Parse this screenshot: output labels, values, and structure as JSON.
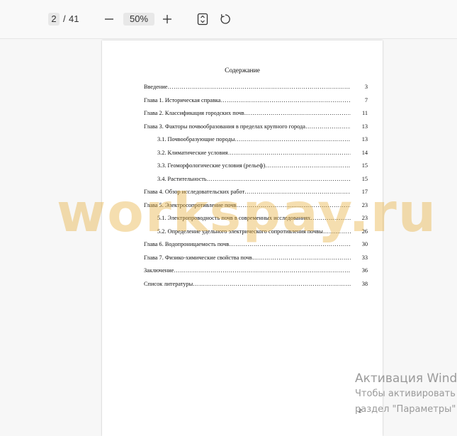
{
  "toolbar": {
    "current_page": "2",
    "page_separator": "/",
    "total_pages": "41",
    "zoom": "50%",
    "icons": {
      "zoom_out": "minus-icon",
      "zoom_in": "plus-icon",
      "fit": "fit-page-icon",
      "rotate": "rotate-icon"
    }
  },
  "document": {
    "title": "Содержание",
    "toc": [
      {
        "text": "Введение",
        "page": "3",
        "indent": false
      },
      {
        "text": "Глава 1. Историческая справка",
        "page": "7",
        "indent": false
      },
      {
        "text": "Глава 2. Классификация городских почв",
        "page": "11",
        "indent": false
      },
      {
        "text": "Глава 3. Факторы почвообразования в пределах крупного города",
        "page": "13",
        "indent": false
      },
      {
        "text": "3.1. Почвообразующие породы",
        "page": "13",
        "indent": true
      },
      {
        "text": "3.2. Климатические условия",
        "page": "14",
        "indent": true
      },
      {
        "text": "3.3. Геоморфологические условия (рельеф)",
        "page": "15",
        "indent": true
      },
      {
        "text": "3.4. Растительность",
        "page": "15",
        "indent": true
      },
      {
        "text": "Глава 4. Обзор исследовательских работ",
        "page": "17",
        "indent": false
      },
      {
        "text": "Глава 5. Электросопротивление почв",
        "page": "23",
        "indent": false
      },
      {
        "text": "5.1. Электропроводность почв в современных исследованиях",
        "page": "23",
        "indent": true
      },
      {
        "text": "5.2. Определение удельного электрического сопротивления почвы",
        "page": "26",
        "indent": true
      },
      {
        "text": "Глава 6. Водопроницаемость почв",
        "page": "30",
        "indent": false
      },
      {
        "text": "Глава 7. Физико-химические свойства почв",
        "page": "33",
        "indent": false
      },
      {
        "text": "Заключение",
        "page": "36",
        "indent": false
      },
      {
        "text": "Список литературы",
        "page": "38",
        "indent": false
      }
    ],
    "footer_page_number": "2"
  },
  "watermark": "workspay.ru",
  "activation": {
    "line1": "Активация Wind",
    "line2": "Чтобы активировать",
    "line3": "раздел \"Параметры\""
  },
  "colors": {
    "watermark": "#e8b040",
    "activation_text": "#9a9a9a",
    "toolbar_bg": "#f9f9f9",
    "viewport_bg": "#f7f7f7"
  }
}
